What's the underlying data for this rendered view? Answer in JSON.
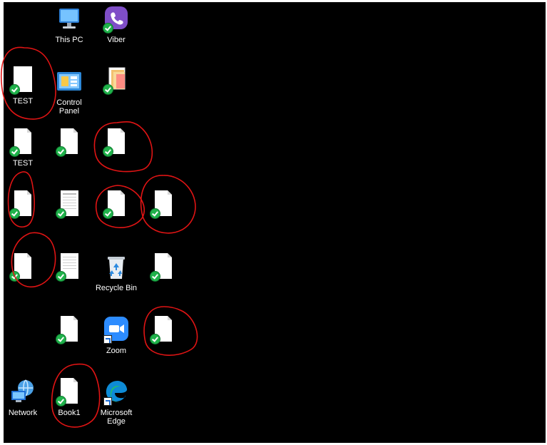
{
  "desktop": {
    "icons": [
      {
        "label": "This PC",
        "icon": "this-pc-icon"
      },
      {
        "label": "Viber",
        "icon": "viber-icon",
        "synced": true
      },
      {
        "label": "TEST",
        "icon": "document-icon",
        "synced": true
      },
      {
        "label": "Control\nPanel",
        "icon": "control-panel-icon"
      },
      {
        "label": "",
        "icon": "folder-icon",
        "synced": true
      },
      {
        "label": "TEST",
        "icon": "document-icon",
        "synced": true
      },
      {
        "label": "",
        "icon": "document-icon",
        "synced": true
      },
      {
        "label": "",
        "icon": "document-icon",
        "synced": true
      },
      {
        "label": "",
        "icon": "document-icon",
        "synced": true
      },
      {
        "label": "",
        "icon": "form-document-icon",
        "synced": true
      },
      {
        "label": "",
        "icon": "document-icon",
        "synced": true
      },
      {
        "label": "",
        "icon": "document-icon",
        "synced": true
      },
      {
        "label": "",
        "icon": "document-icon",
        "synced": true
      },
      {
        "label": "",
        "icon": "form-document-icon",
        "synced": true
      },
      {
        "label": "Recycle Bin",
        "icon": "recycle-bin-icon"
      },
      {
        "label": "",
        "icon": "document-icon",
        "synced": true
      },
      {
        "label": "",
        "icon": "document-icon",
        "synced": true
      },
      {
        "label": "Zoom",
        "icon": "zoom-icon",
        "shortcut": true
      },
      {
        "label": "",
        "icon": "document-icon",
        "synced": true
      },
      {
        "label": "Network",
        "icon": "network-icon"
      },
      {
        "label": "Book1",
        "icon": "document-icon",
        "synced": true
      },
      {
        "label": "Microsoft\nEdge",
        "icon": "edge-icon",
        "shortcut": true
      }
    ]
  },
  "colors": {
    "desktop_background": "#000000",
    "label_text": "#ffffff",
    "annotation_red": "#e01414",
    "sync_green": "#20b24b"
  }
}
